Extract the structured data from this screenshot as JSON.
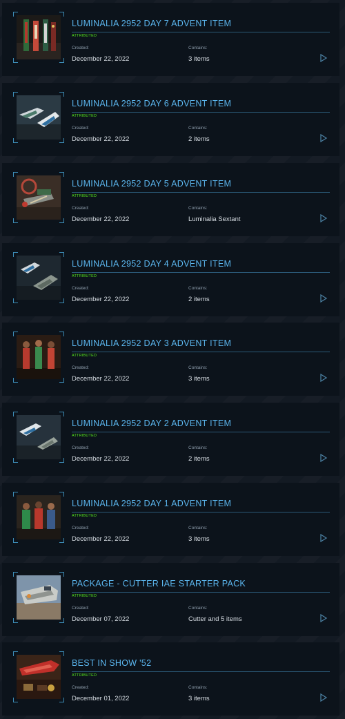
{
  "labels": {
    "created": "Created:",
    "contains": "Contains:"
  },
  "colors": {
    "title": "#5bb6ee",
    "attributed": "#56e81c",
    "frame": "#3d8db8"
  },
  "items": [
    {
      "title": "LUMINALIA 2952 DAY 7 ADVENT ITEM",
      "badge": "ATTRIBUTED",
      "created": "December 22, 2022",
      "contains": "3 items",
      "thumb_icon": "festive-ship-decorations-thumbnail"
    },
    {
      "title": "LUMINALIA 2952 DAY 6 ADVENT ITEM",
      "badge": "ATTRIBUTED",
      "created": "December 22, 2022",
      "contains": "2 items",
      "thumb_icon": "ships-thumbnail"
    },
    {
      "title": "LUMINALIA 2952 DAY 5 ADVENT ITEM",
      "badge": "ATTRIBUTED",
      "created": "December 22, 2022",
      "contains": "Luminalia Sextant",
      "thumb_icon": "sextant-thumbnail"
    },
    {
      "title": "LUMINALIA 2952 DAY 4 ADVENT ITEM",
      "badge": "ATTRIBUTED",
      "created": "December 22, 2022",
      "contains": "2 items",
      "thumb_icon": "ships-thumbnail"
    },
    {
      "title": "LUMINALIA 2952 DAY 3 ADVENT ITEM",
      "badge": "ATTRIBUTED",
      "created": "December 22, 2022",
      "contains": "3 items",
      "thumb_icon": "outfits-thumbnail"
    },
    {
      "title": "LUMINALIA 2952 DAY 2 ADVENT ITEM",
      "badge": "ATTRIBUTED",
      "created": "December 22, 2022",
      "contains": "2 items",
      "thumb_icon": "ships-thumbnail"
    },
    {
      "title": "LUMINALIA 2952 DAY 1 ADVENT ITEM",
      "badge": "ATTRIBUTED",
      "created": "December 22, 2022",
      "contains": "3 items",
      "thumb_icon": "sweaters-thumbnail"
    },
    {
      "title": "PACKAGE - CUTTER IAE STARTER PACK",
      "badge": "ATTRIBUTED",
      "created": "December 07, 2022",
      "contains": "Cutter and 5 items",
      "thumb_icon": "cutter-ship-thumbnail"
    },
    {
      "title": "BEST IN SHOW '52",
      "badge": "ATTRIBUTED",
      "created": "December 01, 2022",
      "contains": "3 items",
      "thumb_icon": "red-ship-model-thumbnail"
    }
  ]
}
